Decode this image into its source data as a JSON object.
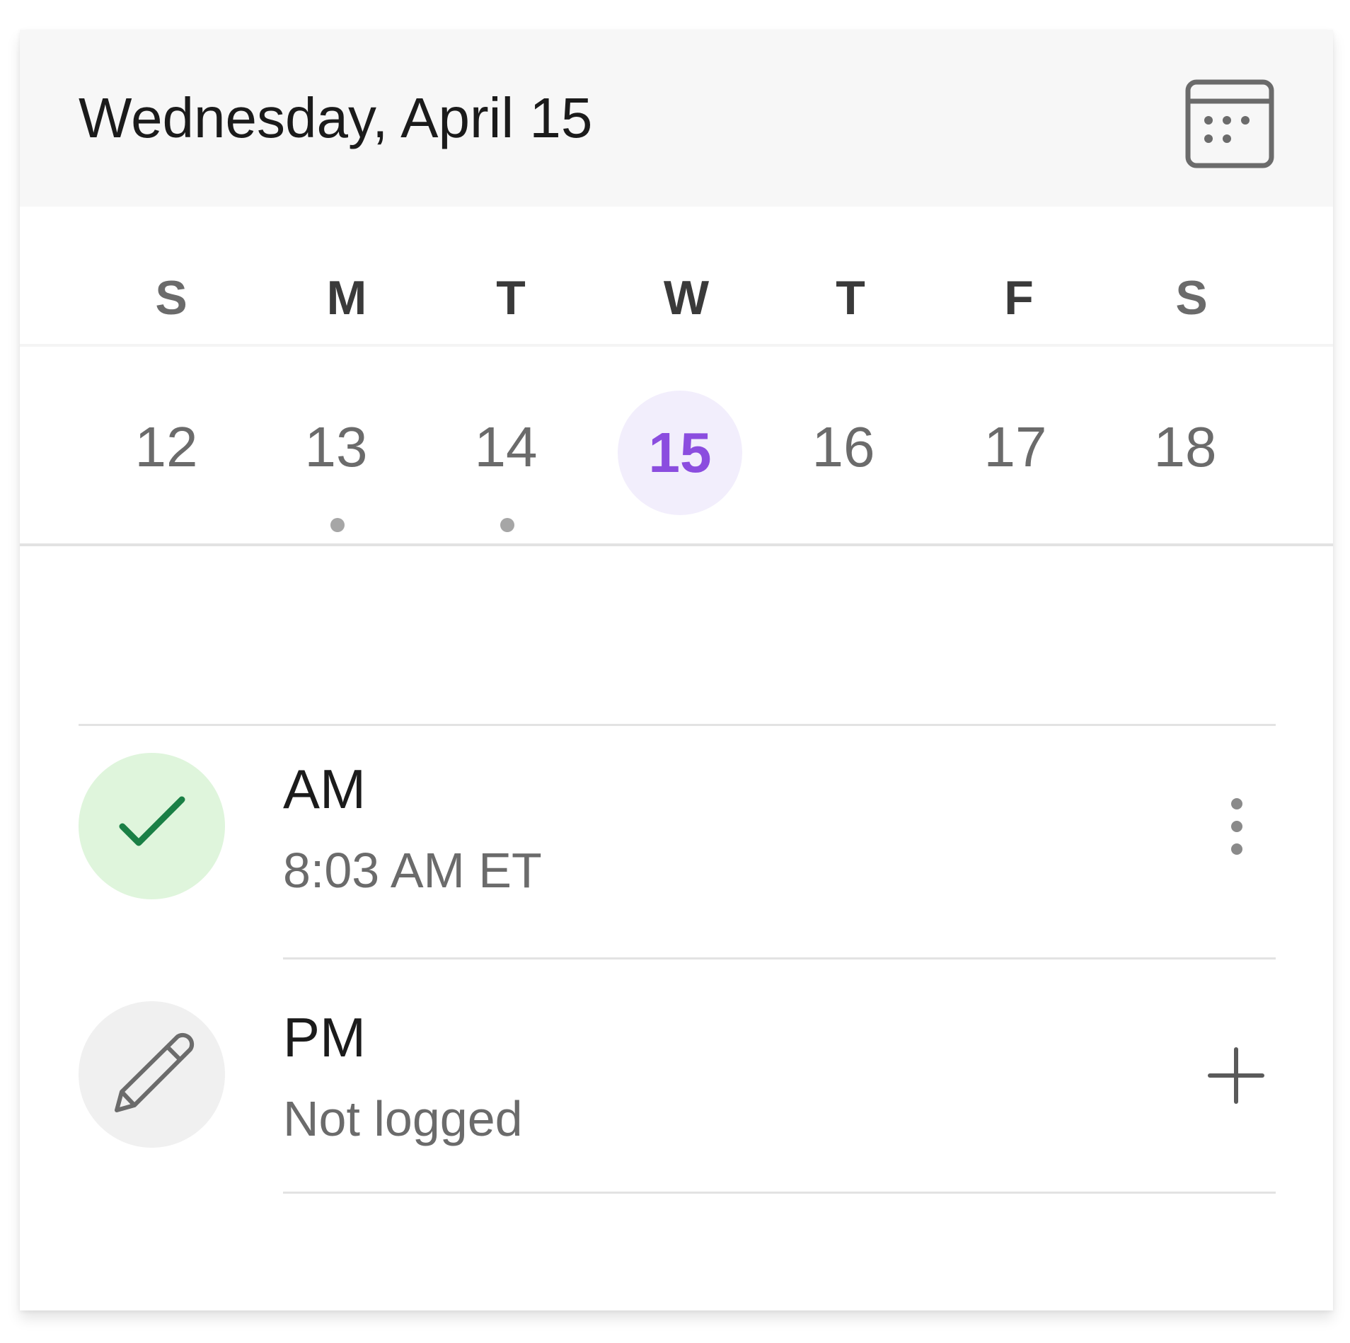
{
  "header": {
    "title": "Wednesday, April 15",
    "calendar_icon": "calendar-grid-icon"
  },
  "week": {
    "weekdays": [
      "S",
      "M",
      "T",
      "W",
      "T",
      "F",
      "S"
    ],
    "dates": [
      "12",
      "13",
      "14",
      "15",
      "16",
      "17",
      "18"
    ],
    "selected_date": "15",
    "dates_with_events": [
      "13",
      "14"
    ]
  },
  "entries": [
    {
      "title": "AM",
      "subtitle": "8:03 AM ET",
      "status": "logged",
      "status_icon": "checkmark-icon",
      "action_icon": "more-vertical-icon"
    },
    {
      "title": "PM",
      "subtitle": "Not logged",
      "status": "not-logged",
      "status_icon": "pencil-icon",
      "action_icon": "plus-icon"
    }
  ],
  "colors": {
    "header_bg": "#f7f7f7",
    "selected_date_bg": "#f2eefc",
    "selected_date_text": "#8b4ddf",
    "logged_circle_bg": "#dff5dc",
    "logged_check": "#1a7f45",
    "pending_circle_bg": "#f0f0f0",
    "event_dot": "#a6a6a6"
  }
}
